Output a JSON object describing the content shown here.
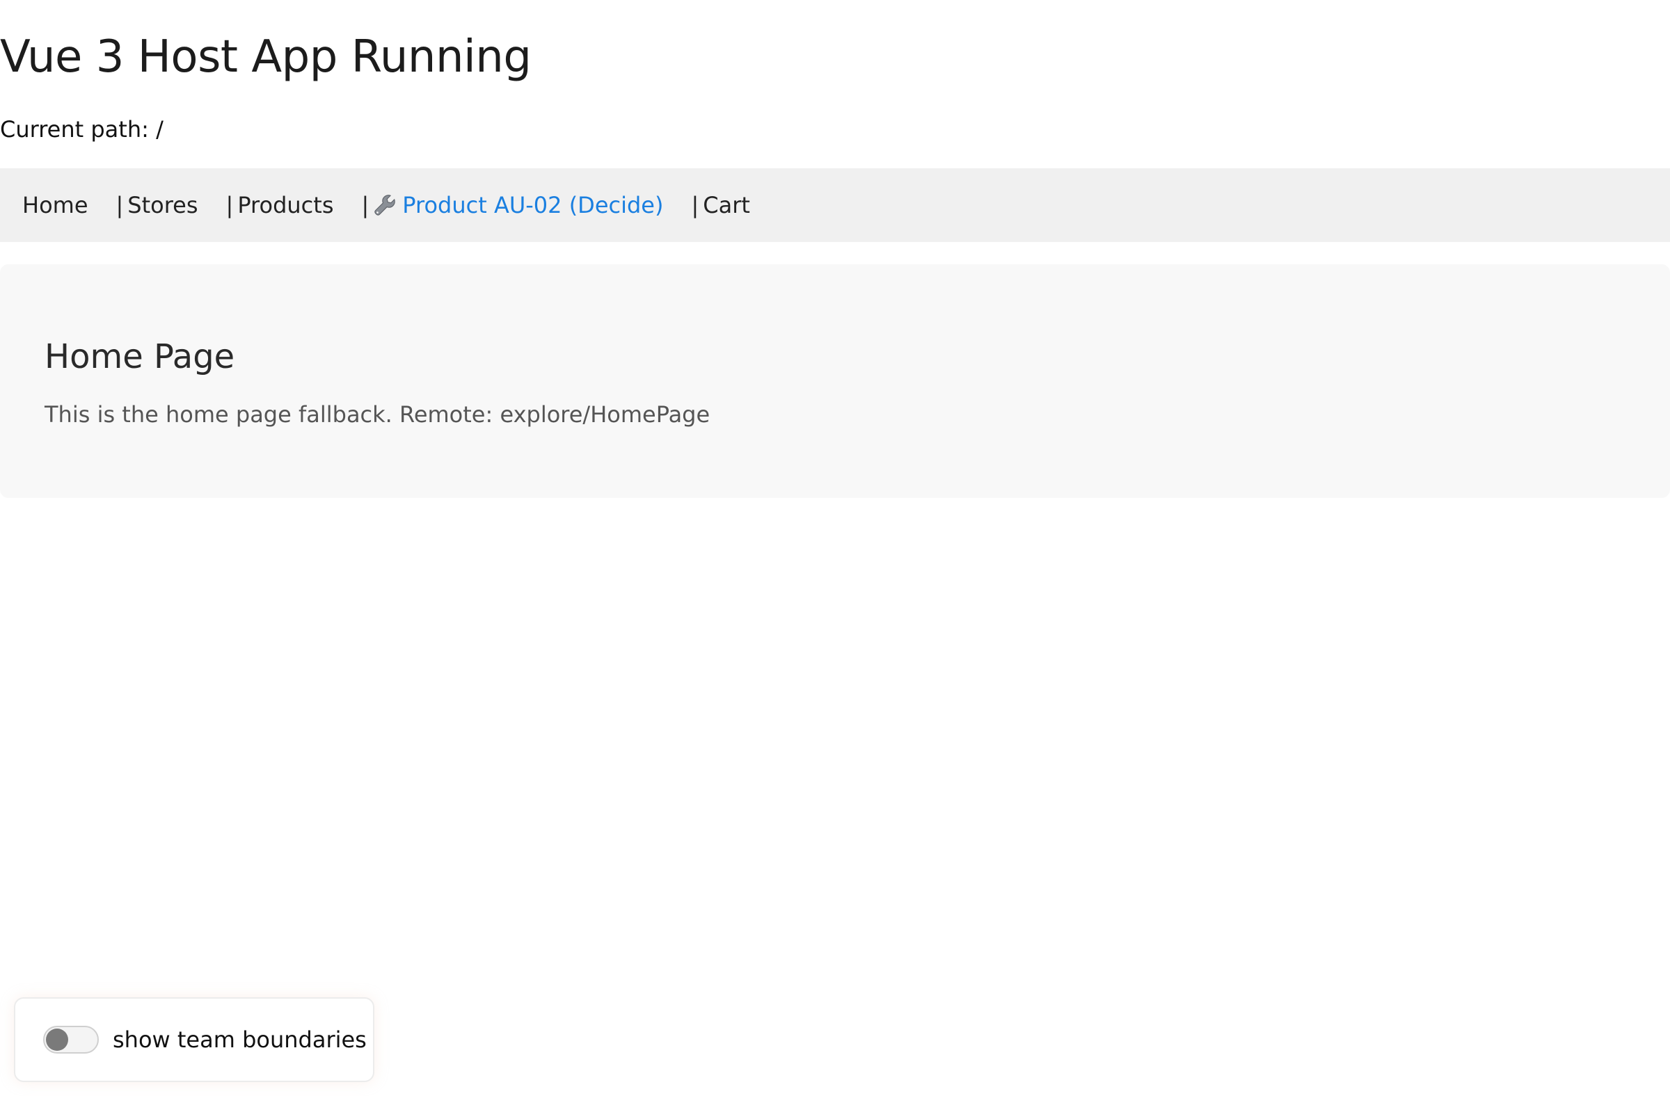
{
  "app": {
    "title": "Vue 3 Host App Running",
    "current_path_label": "Current path: /"
  },
  "nav": {
    "items": [
      {
        "label": "Home",
        "separator": ""
      },
      {
        "label": "Stores",
        "separator": "|"
      },
      {
        "label": "Products",
        "separator": "|"
      },
      {
        "label": "Product AU-02 (Decide)",
        "separator": "|",
        "icon": "wrench-icon",
        "active": true
      },
      {
        "label": "Cart",
        "separator": "|"
      }
    ],
    "active_color": "#1a7fe0"
  },
  "main": {
    "heading": "Home Page",
    "description": "This is the home page fallback. Remote: explore/HomePage"
  },
  "toggle": {
    "label": "show team boundaries",
    "state": "off"
  }
}
